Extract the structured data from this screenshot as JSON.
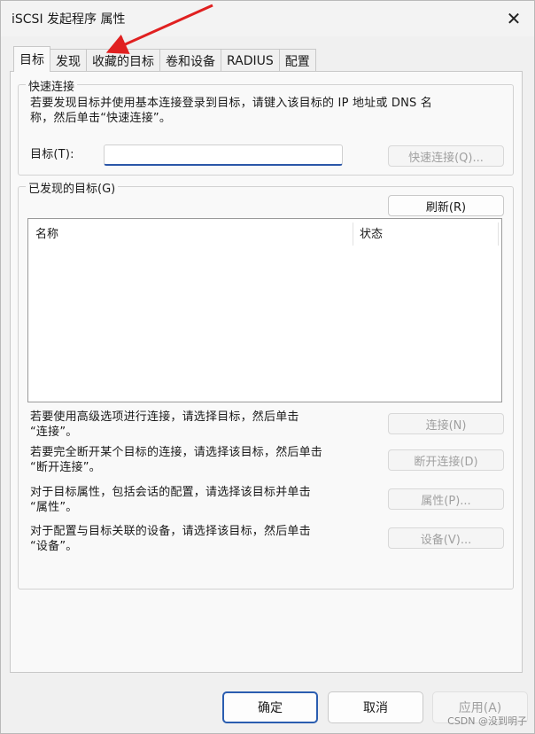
{
  "window": {
    "title": "iSCSI 发起程序 属性",
    "close_glyph": "✕"
  },
  "tabs": [
    {
      "label": "目标",
      "active": true
    },
    {
      "label": "发现",
      "active": false
    },
    {
      "label": "收藏的目标",
      "active": false
    },
    {
      "label": "卷和设备",
      "active": false
    },
    {
      "label": "RADIUS",
      "active": false
    },
    {
      "label": "配置",
      "active": false
    }
  ],
  "quick_connect": {
    "title": "快速连接",
    "description_line1": "若要发现目标并使用基本连接登录到目标，请键入该目标的 IP 地址或 DNS 名",
    "description_line2": "称，然后单击“快速连接”。",
    "target_label": "目标(T):",
    "target_value": "",
    "button_label": "快速连接(Q)..."
  },
  "discovered": {
    "title": "已发现的目标(G)",
    "refresh_label": "刷新(R)",
    "columns": [
      "名称",
      "状态"
    ],
    "rows": []
  },
  "actions": [
    {
      "line1": "若要使用高级选项进行连接，请选择目标，然后单击",
      "line2": "“连接”。",
      "button": "连接(N)",
      "enabled": false
    },
    {
      "line1": "若要完全断开某个目标的连接，请选择该目标，然后单击",
      "line2": "“断开连接”。",
      "button": "断开连接(D)",
      "enabled": false
    },
    {
      "line1": "对于目标属性，包括会话的配置，请选择该目标并单击",
      "line2": "“属性”。",
      "button": "属性(P)...",
      "enabled": false
    },
    {
      "line1": "对于配置与目标关联的设备，请选择该目标，然后单击",
      "line2": "“设备”。",
      "button": "设备(V)...",
      "enabled": false
    }
  ],
  "footer": {
    "ok": "确定",
    "cancel": "取消",
    "apply": "应用(A)"
  },
  "watermark": "CSDN @没到明子",
  "colors": {
    "accent": "#2a5db0",
    "arrow": "#e02020"
  }
}
